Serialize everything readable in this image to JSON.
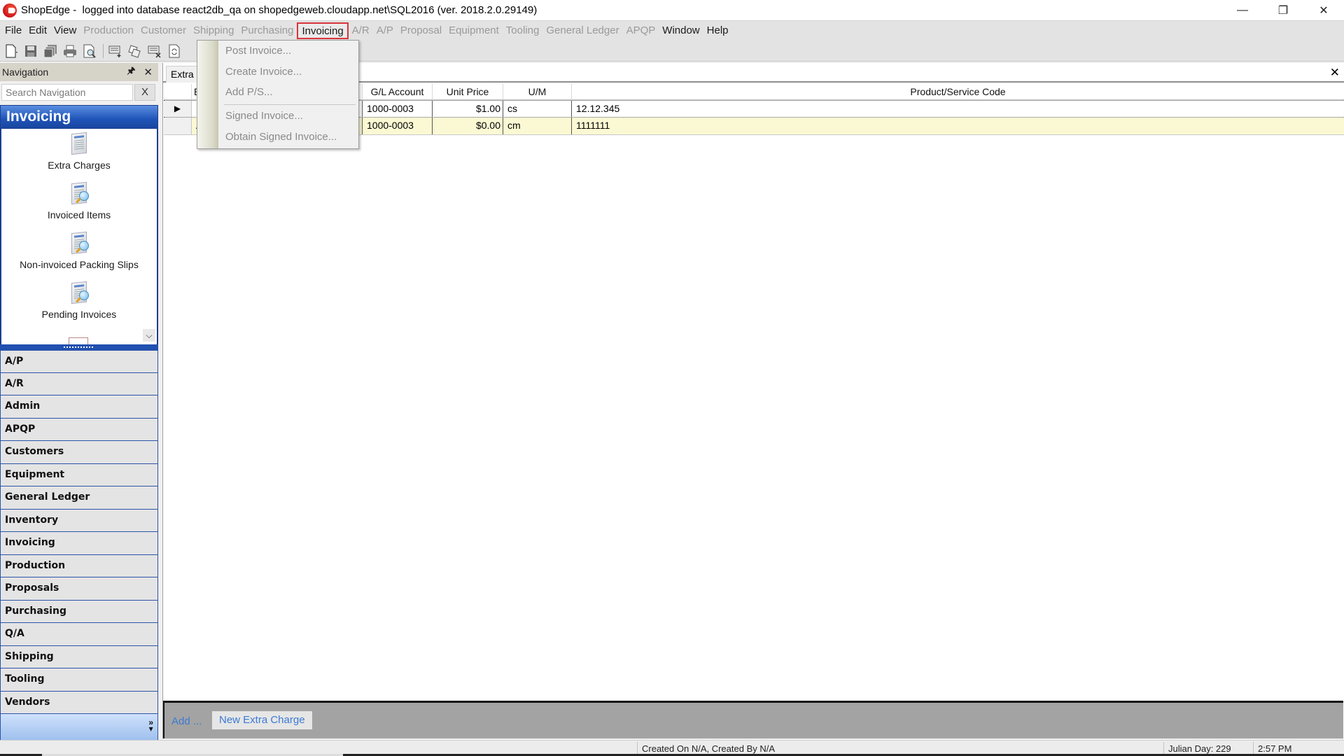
{
  "window": {
    "title": "ShopEdge -  logged into database react2db_qa on shopedgeweb.cloudapp.net\\SQL2016 (ver. 2018.2.0.29149)",
    "controls": {
      "minimize": "—",
      "restore": "❐",
      "close": "✕"
    }
  },
  "menubar": {
    "items": [
      {
        "label": "File",
        "enabled": true
      },
      {
        "label": "Edit",
        "enabled": true
      },
      {
        "label": "View",
        "enabled": true
      },
      {
        "label": "Production",
        "enabled": false
      },
      {
        "label": "Customer",
        "enabled": false
      },
      {
        "label": "Shipping",
        "enabled": false
      },
      {
        "label": "Purchasing",
        "enabled": false
      },
      {
        "label": "Invoicing",
        "enabled": true,
        "active": true
      },
      {
        "label": "A/R",
        "enabled": false
      },
      {
        "label": "A/P",
        "enabled": false
      },
      {
        "label": "Proposal",
        "enabled": false
      },
      {
        "label": "Equipment",
        "enabled": false
      },
      {
        "label": "Tooling",
        "enabled": false
      },
      {
        "label": "General Ledger",
        "enabled": false
      },
      {
        "label": "APQP",
        "enabled": false
      },
      {
        "label": "Window",
        "enabled": true
      },
      {
        "label": "Help",
        "enabled": true
      }
    ]
  },
  "toolbar": {
    "icons": [
      "new-document-icon",
      "save-icon",
      "save-all-icon",
      "print-icon",
      "print-preview-icon",
      "add-record-icon",
      "copy-record-icon",
      "delete-record-icon",
      "refresh-icon"
    ]
  },
  "invoicing_menu": {
    "items": [
      {
        "label": "Post Invoice...",
        "enabled": false
      },
      {
        "label": "Create Invoice...",
        "enabled": false
      },
      {
        "label": "Add P/S...",
        "enabled": false
      },
      {
        "label": "Signed Invoice...",
        "enabled": false
      },
      {
        "label": "Obtain Signed Invoice...",
        "enabled": false
      }
    ]
  },
  "navigation": {
    "title": "Navigation",
    "pin": "⭍",
    "close": "✕",
    "search": {
      "placeholder": "Search Navigation",
      "value": "",
      "clear_label": "X"
    },
    "active_group": "Invoicing",
    "group_items": [
      {
        "label": "Extra Charges",
        "icon": "invoice-document-icon"
      },
      {
        "label": "Invoiced Items",
        "icon": "invoice-search-icon"
      },
      {
        "label": "Non-invoiced Packing Slips",
        "icon": "invoice-search-icon"
      },
      {
        "label": "Pending Invoices",
        "icon": "invoice-search-icon"
      }
    ],
    "modules": [
      "A/P",
      "A/R",
      "Admin",
      "APQP",
      "Customers",
      "Equipment",
      "General Ledger",
      "Inventory",
      "Invoicing",
      "Production",
      "Proposals",
      "Purchasing",
      "Q/A",
      "Shipping",
      "Tooling",
      "Vendors"
    ],
    "footer_more": "»"
  },
  "document": {
    "tab_label": "Extra",
    "close": "✕",
    "grid": {
      "columns": [
        "E",
        "G/L Account",
        "Unit Price",
        "U/M",
        "Product/Service Code"
      ],
      "rows": [
        {
          "indicator": "▶",
          "first": "I",
          "gl_account": "1000-0003",
          "unit_price": "$1.00",
          "um": "cs",
          "code": "12.12.345"
        },
        {
          "indicator": "",
          "first": "A",
          "gl_account": "1000-0003",
          "unit_price": "$0.00",
          "um": "cm",
          "code": "1111111"
        }
      ]
    },
    "bottom": {
      "add_label": "Add ...",
      "new_button": "New Extra Charge"
    }
  },
  "statusbar": {
    "created": "Created On N/A, Created By N/A",
    "julian_day": "Julian Day: 229",
    "time": "2:57 PM"
  },
  "colors": {
    "accent_blue": "#1f54b8",
    "active_menu_border": "#d9343a",
    "new_row_bg": "#fbf9d3",
    "link_blue": "#3b7ad4"
  }
}
